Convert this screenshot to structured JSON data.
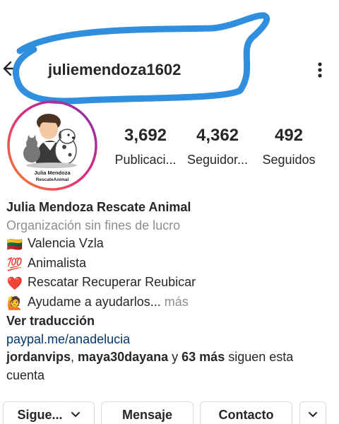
{
  "header": {
    "username": "juliemendoza1602",
    "back_icon": "arrow-left-icon",
    "more_icon": "kebab-vertical-icon",
    "annotation_color": "#2f8fde"
  },
  "profile": {
    "avatar_icon": "profile-avatar-icon",
    "avatar_ring_color": "#c13584",
    "avatar_caption_line1": "Julia Mendoza",
    "avatar_caption_line2": "RescateAnimal",
    "stats": {
      "posts_count": "3,692",
      "posts_label": "Publicaci...",
      "followers_count": "4,362",
      "followers_label": "Seguidor...",
      "following_count": "492",
      "following_label": "Seguidos"
    }
  },
  "bio": {
    "name": "Julia Mendoza Rescate Animal",
    "category": "Organización sin fines de lucro",
    "lines": [
      {
        "emoji": "🇱🇹",
        "text": "Valencia Vzla"
      },
      {
        "emoji": "💯",
        "text": "Animalista"
      },
      {
        "emoji": "❤️",
        "text": "Rescatar Recuperar Reubicar"
      },
      {
        "emoji": "🙋",
        "text": "Ayudame a ayudarlos..."
      }
    ],
    "more_label": " más",
    "translate_label": "Ver traducción",
    "link": "paypal.me/anadelucia",
    "followed_by": {
      "user1": "jordanvips",
      "separator": ", ",
      "user2": "maya30dayana",
      "connector": " y ",
      "others": "63 más",
      "suffix_line1": " siguen esta",
      "suffix_line2": "cuenta"
    }
  },
  "actions": {
    "follow_label": "Sigue...",
    "message_label": "Mensaje",
    "contact_label": "Contacto",
    "chevron_icon": "chevron-down-icon"
  }
}
